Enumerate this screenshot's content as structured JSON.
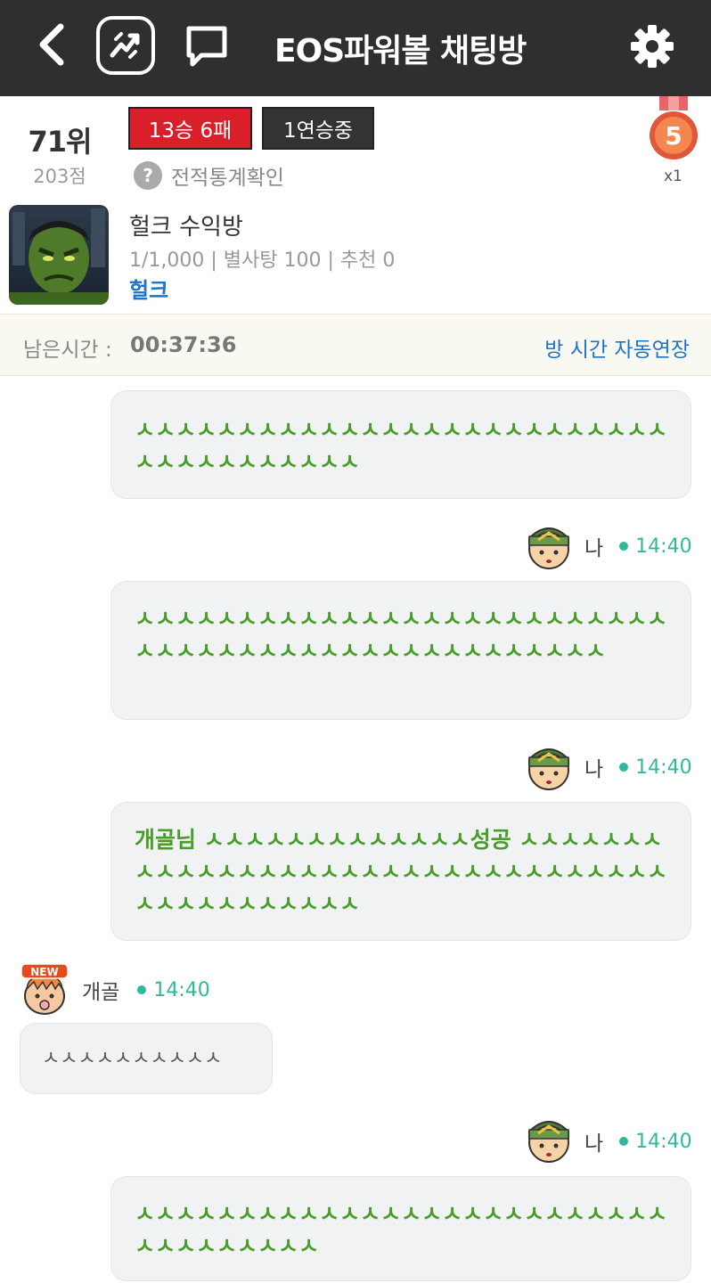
{
  "header": {
    "title": "EOS파워볼 채팅방",
    "icons": [
      "back-arrow-icon",
      "logo-icon",
      "chat-icon",
      "gear-icon"
    ]
  },
  "room": {
    "rank": "71위",
    "points": "203점",
    "record": "13승 6패",
    "streak": "1연승중",
    "stats_link": "전적통계확인",
    "medal_number": "5",
    "medal_count": "x1",
    "name": "헐크 수익방",
    "meta": "1/1,000 | 별사탕 100 | 추천 0",
    "owner": "헐크"
  },
  "timer": {
    "label": "남은시간 :",
    "value": "00:37:36",
    "extend_label": "방 시간 자동연장"
  },
  "messages": [
    {
      "id": "m1",
      "text": "ㅅㅅㅅㅅㅅㅅㅅㅅㅅㅅㅅㅅㅅㅅㅅㅅㅅㅅㅅㅅㅅㅅㅅㅅㅅㅅㅅㅅㅅㅅㅅㅅㅅㅅㅅㅅㅅ"
    },
    {
      "id": "m2",
      "sender": "나",
      "time": "14:40",
      "text": "ㅅㅅㅅㅅㅅㅅㅅㅅㅅㅅㅅㅅㅅㅅㅅㅅㅅㅅㅅㅅㅅㅅㅅㅅㅅㅅㅅㅅㅅㅅㅅㅅㅅㅅㅅㅅㅅㅅㅅㅅㅅㅅㅅㅅㅅㅅㅅㅅㅅ"
    },
    {
      "id": "m3",
      "sender": "나",
      "time": "14:40",
      "text": "개골님 ㅅㅅㅅㅅㅅㅅㅅㅅㅅㅅㅅㅅㅅ성공 ㅅㅅㅅㅅㅅㅅㅅㅅㅅㅅㅅㅅㅅㅅㅅㅅㅅㅅㅅㅅㅅㅅㅅㅅㅅㅅㅅㅅㅅㅅㅅㅅㅅㅅㅅㅅㅅㅅㅅㅅㅅㅅㅅㅅ"
    },
    {
      "id": "m4",
      "sender": "개골",
      "time": "14:40",
      "badge": "NEW",
      "text": "ㅅㅅㅅㅅㅅㅅㅅㅅㅅㅅ"
    },
    {
      "id": "m5",
      "sender": "나",
      "time": "14:40",
      "text": "ㅅㅅㅅㅅㅅㅅㅅㅅㅅㅅㅅㅅㅅㅅㅅㅅㅅㅅㅅㅅㅅㅅㅅㅅㅅㅅㅅㅅㅅㅅㅅㅅㅅㅅㅅ"
    }
  ],
  "colors": {
    "header_bg": "#2f2f2f",
    "record_red": "#d9202a",
    "link_blue": "#1e74c8",
    "message_green": "#4a9d2a",
    "time_teal": "#2fb89a"
  }
}
